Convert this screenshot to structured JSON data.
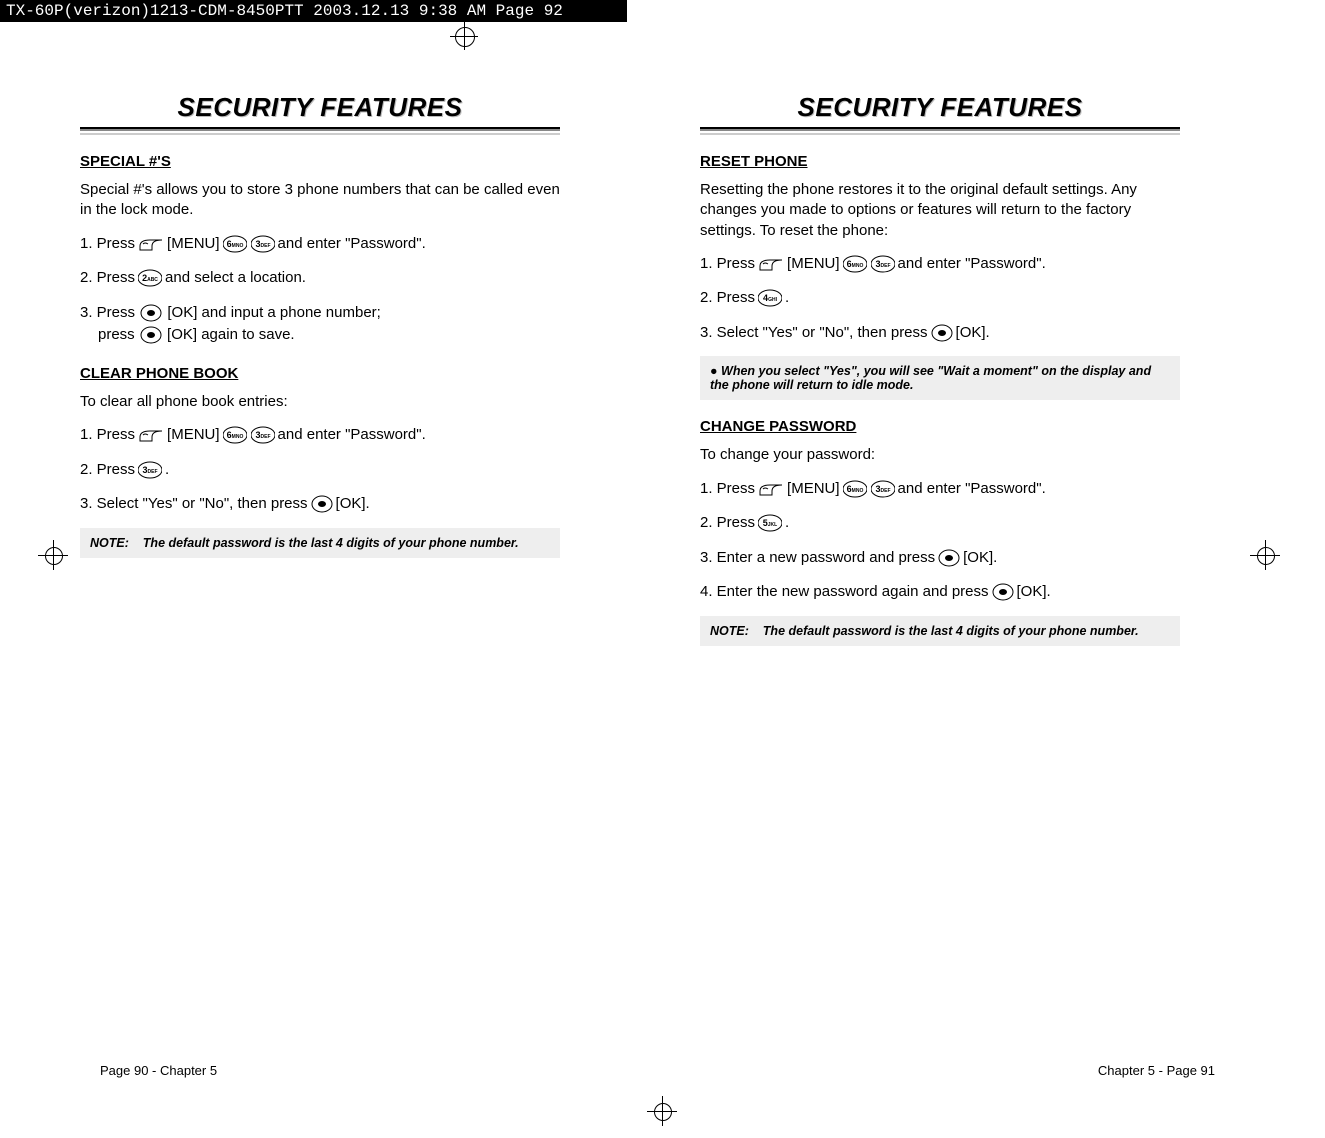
{
  "header": "TX-60P(verizon)1213-CDM-8450PTT  2003.12.13  9:38 AM  Page 92",
  "title": "SECURITY FEATURES",
  "left": {
    "sec1_head": "SPECIAL #'S",
    "sec1_body": "Special #'s allows you to store 3 phone numbers that can be called even in the lock mode.",
    "s1_a": "1. Press ",
    "s1_b": " [MENU] ",
    "s1_c": " and enter \"Password\".",
    "s2_a": "2. Press ",
    "s2_b": " and select a location.",
    "s3_a": "3. Press ",
    "s3_b": " [OK] and input a phone number;",
    "s3_c": "press ",
    "s3_d": " [OK] again to save.",
    "sec2_head": "CLEAR PHONE BOOK",
    "sec2_body": "To clear all phone book entries:",
    "c1_a": "1. Press ",
    "c1_b": " [MENU] ",
    "c1_c": " and enter \"Password\".",
    "c2_a": "2. Press ",
    "c2_b": ".",
    "c3_a": "3. Select \"Yes\" or \"No\", then press ",
    "c3_b": " [OK].",
    "note_label": "NOTE:",
    "note_text": "The default password is the last 4 digits of your phone number.",
    "footer": "Page 90 - Chapter 5"
  },
  "right": {
    "sec1_head": "RESET PHONE",
    "sec1_body": "Resetting the phone restores it to the original default settings. Any changes you made to options or features will return to the factory settings. To reset the phone:",
    "r1_a": "1. Press ",
    "r1_b": " [MENU] ",
    "r1_c": " and enter \"Password\".",
    "r2_a": "2. Press",
    "r2_b": ".",
    "r3_a": "3. Select \"Yes\" or \"No\", then press ",
    "r3_b": "[OK].",
    "bullet": "● When you select \"Yes\", you will see \"Wait a moment\" on the display and the phone will return to idle mode.",
    "sec2_head": "CHANGE PASSWORD",
    "sec2_body": "To change your password:",
    "p1_a": "1. Press ",
    "p1_b": " [MENU] ",
    "p1_c": " and enter \"Password\".",
    "p2_a": "2. Press ",
    "p2_b": " .",
    "p3_a": "3. Enter a new password and press ",
    "p3_b": "[OK].",
    "p4_a": "4. Enter the new password again and press ",
    "p4_b": "[OK].",
    "note_label": "NOTE:",
    "note_text": "The default password is the last 4 digits of your phone number.",
    "footer": "Chapter 5 - Page 91"
  }
}
